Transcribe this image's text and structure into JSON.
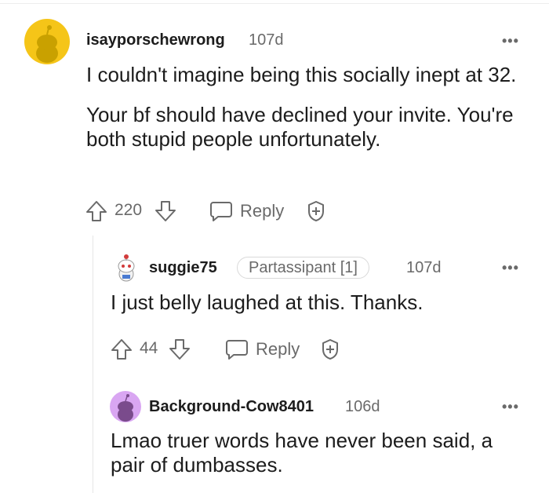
{
  "comments": [
    {
      "username": "isayporschewrong",
      "age": "107d",
      "paragraphs": [
        "I couldn't imagine being this socially inept at 32.",
        "Your bf should have declined your invite. You're both stupid people unfortunately."
      ],
      "score": "220",
      "reply_label": "Reply",
      "avatar_color": "#f5c518"
    },
    {
      "username": "suggie75",
      "flair": "Partassipant [1]",
      "age": "107d",
      "paragraphs": [
        "I just belly laughed at this. Thanks."
      ],
      "score": "44",
      "reply_label": "Reply"
    },
    {
      "username": "Background-Cow8401",
      "age": "106d",
      "paragraphs": [
        "Lmao truer words have never been said, a pair of dumbasses."
      ],
      "avatar_color": "#d9a6f2"
    }
  ],
  "more_label": "•••",
  "colors": {
    "text": "#1c1c1c",
    "muted": "#6a6a6a",
    "divider": "#e6e6e6"
  }
}
